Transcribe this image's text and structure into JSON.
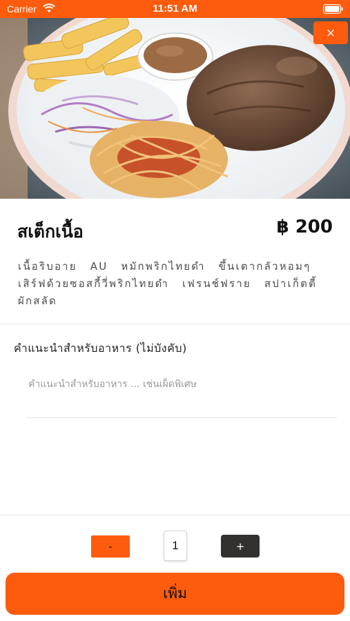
{
  "status_bar": {
    "carrier": "Carrier",
    "time": "11:51 AM",
    "icons": [
      "wifi-icon",
      "battery-icon"
    ],
    "color": "#fd5b0d"
  },
  "hero": {
    "image": "steak-plate-photo",
    "close_label": "×"
  },
  "item": {
    "name": "สเต็กเนื้อ",
    "price": "฿ 200",
    "description": "เนื้อริบอาย AU หมักพริกไทยดำ ขึ้นเตากลัวหอมๆ เสิร์ฟด้วยซอสกี้วี่พริกไทยดำ เฟรนช์ฟราย สปาเก็ตตี้ ผักสลัด"
  },
  "note": {
    "label": "คำแนะนำสำหรับอาหาร (ไม่บังคับ)",
    "value": "",
    "placeholder": "คำแนะนำสำหรับอาหาร ... เช่นเผ็ดพิเศษ"
  },
  "quantity": {
    "minus_label": "-",
    "value": "1",
    "plus_label": "+"
  },
  "add_button": {
    "label": "เพิ่ม"
  },
  "colors": {
    "accent": "#fd5b0d",
    "dark_button": "#333030"
  }
}
